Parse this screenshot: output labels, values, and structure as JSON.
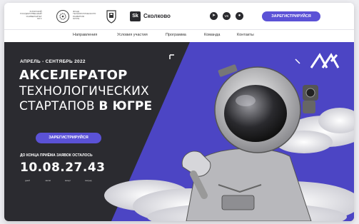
{
  "header": {
    "university_text": [
      "ЮГОРСКИЙ",
      "ГОСУДАРСТВЕННЫЙ",
      "УНИВЕРСИТЕТ",
      "ЮГУ"
    ],
    "partner_text": [
      "ФОНД",
      "ТЕХНОЛОГИЧЕСКОГО",
      "РАЗВИТИЯ",
      "ЮГРЫ"
    ],
    "skolkovo_badge": "Sk",
    "skolkovo_name": "Сколково",
    "social": [
      "telegram-icon",
      "vk-icon",
      "ok-icon"
    ],
    "register_label": "ЗАРЕГИСТРИРУЙСЯ"
  },
  "nav": {
    "items": [
      "Направления",
      "Условия участия",
      "Программа",
      "Команда",
      "Контакты"
    ]
  },
  "hero": {
    "kicker": "АПРЕЛЬ - СЕНТЯБРЬ 2022",
    "title_1": "АКСЕЛЕРАТОР",
    "title_2": "ТЕХНОЛОГИЧЕСКИХ",
    "title_3_regular": "СТАРТАПОВ",
    "title_3_bold": "В ЮГРЕ",
    "register_label": "ЗАРЕГИСТРИРУЙСЯ",
    "deadline_text": "ДО КОНЦА ПРИЁМА ЗАЯВОК ОСТАЛОСЬ",
    "countdown": "10.08.27.43",
    "countdown_labels": [
      "дней",
      "часов",
      "минут",
      "секунд"
    ]
  },
  "colors": {
    "accent": "#5b52d6",
    "dark_bg": "#2b2b30",
    "purple_panel": "#4c45c4"
  }
}
